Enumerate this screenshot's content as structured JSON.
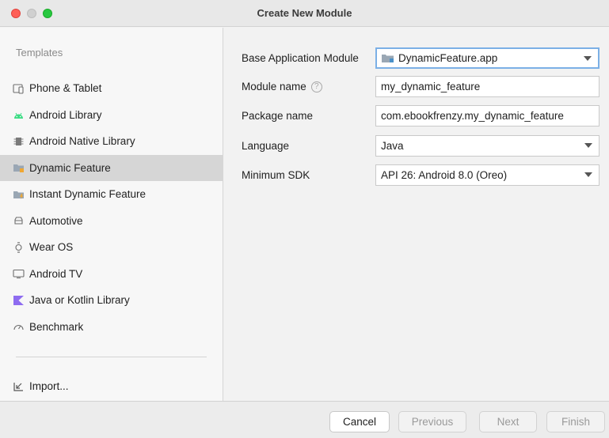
{
  "window": {
    "title": "Create New Module"
  },
  "sidebar": {
    "section_label": "Templates",
    "items": [
      {
        "label": "Phone & Tablet",
        "icon": "phone-tablet-icon"
      },
      {
        "label": "Android Library",
        "icon": "android-icon"
      },
      {
        "label": "Android Native Library",
        "icon": "native-library-icon"
      },
      {
        "label": "Dynamic Feature",
        "icon": "dynamic-feature-folder-icon",
        "selected": true
      },
      {
        "label": "Instant Dynamic Feature",
        "icon": "instant-feature-folder-icon"
      },
      {
        "label": "Automotive",
        "icon": "car-icon"
      },
      {
        "label": "Wear OS",
        "icon": "watch-icon"
      },
      {
        "label": "Android TV",
        "icon": "tv-icon"
      },
      {
        "label": "Java or Kotlin Library",
        "icon": "kotlin-icon"
      },
      {
        "label": "Benchmark",
        "icon": "gauge-icon"
      }
    ],
    "import_label": "Import..."
  },
  "form": {
    "base_module": {
      "label": "Base Application Module",
      "value": "DynamicFeature.app"
    },
    "module_name": {
      "label": "Module name",
      "value": "my_dynamic_feature"
    },
    "package_name": {
      "label": "Package name",
      "value": "com.ebookfrenzy.my_dynamic_feature"
    },
    "language": {
      "label": "Language",
      "value": "Java"
    },
    "min_sdk": {
      "label": "Minimum SDK",
      "value": "API 26: Android 8.0 (Oreo)"
    }
  },
  "buttons": {
    "cancel": "Cancel",
    "previous": "Previous",
    "next": "Next",
    "finish": "Finish"
  },
  "colors": {
    "accent_focus": "#7cb0e6",
    "selected_row": "#d6d6d6",
    "android_green": "#3ddc84",
    "folder_blue": "#4a90c8"
  }
}
